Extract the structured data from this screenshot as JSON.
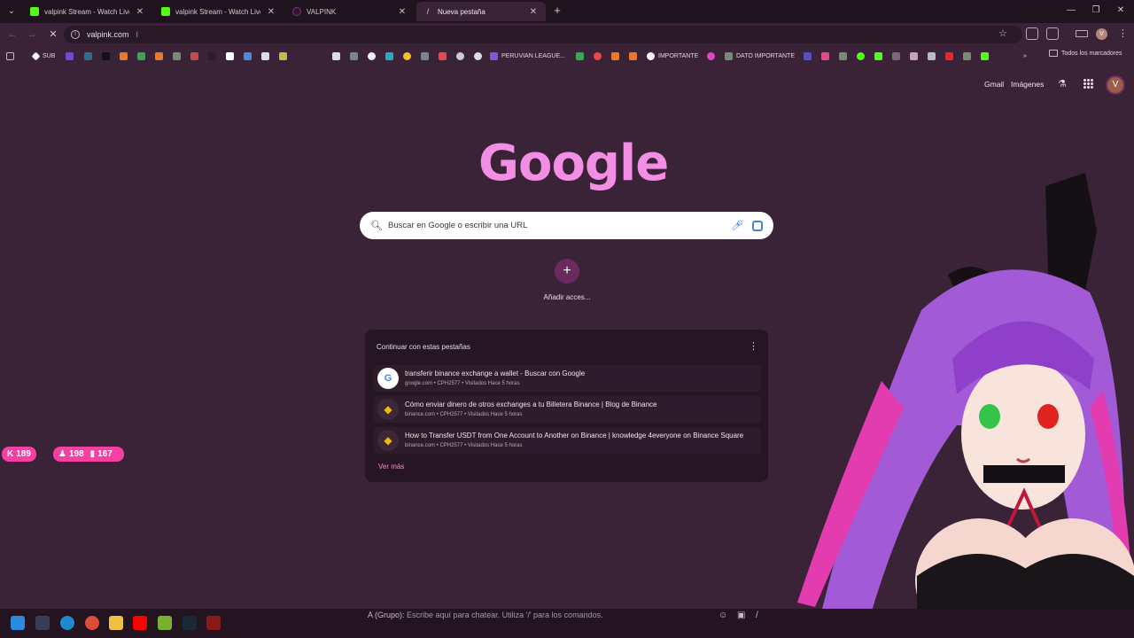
{
  "tabs": [
    {
      "title": "valpink Stream - Watch Live on",
      "favicon": "kick-icon",
      "active": false
    },
    {
      "title": "valpink Stream - Watch Live on",
      "favicon": "kick-icon",
      "active": false
    },
    {
      "title": "VALPINK",
      "favicon": "valpink-icon",
      "active": false
    },
    {
      "title": "Nueva pestaña",
      "favicon": "new-tab-icon",
      "active": true
    }
  ],
  "omnibox": {
    "url": "valpink.com"
  },
  "bookmarks": {
    "items": [
      {
        "label": "SUB"
      },
      {
        "label": "PERUVIAN LEAGUE..."
      },
      {
        "label": "IMPORTANTE"
      },
      {
        "label": "DATO IMPORTANTE"
      }
    ],
    "folder": "Todos los marcadores"
  },
  "google": {
    "gmail": "Gmail",
    "images": "Imágenes",
    "logo": "Google",
    "avatar_letter": "V",
    "search_placeholder": "Buscar en Google o escribir una URL",
    "shortcut_label": "Añadir acces..."
  },
  "continue_card": {
    "heading": "Continuar con estas pestañas",
    "items": [
      {
        "title": "transferir binance exchange a wallet - Buscar con Google",
        "subtitle": "google.com • CPH2577 • Visitados Hace 5 horas",
        "icon": "google-icon"
      },
      {
        "title": "Cómo enviar dinero de otros exchanges a tu Billetera Binance | Blog de Binance",
        "subtitle": "binance.com • CPH2577 • Visitados Hace 5 horas",
        "icon": "binance-icon"
      },
      {
        "title": "How to Transfer USDT from One Account to Another on Binance | knowledge 4everyone on Binance Square",
        "subtitle": "binance.com • CPH2577 • Visitados Hace 5 horas",
        "icon": "binance-icon"
      }
    ],
    "more": "Ver más"
  },
  "stream_stats": {
    "subs": "189",
    "followers": "198",
    "viewers": "167"
  },
  "chat": {
    "prefix": "A (Grupo):",
    "placeholder": "Escribe aquí para chatear. Utiliza '/' para los comandos."
  },
  "colors": {
    "page_bg": "#3a2337",
    "logo": "#f28ee4",
    "accent": "#f53fa2",
    "kick": "#53fc18"
  }
}
